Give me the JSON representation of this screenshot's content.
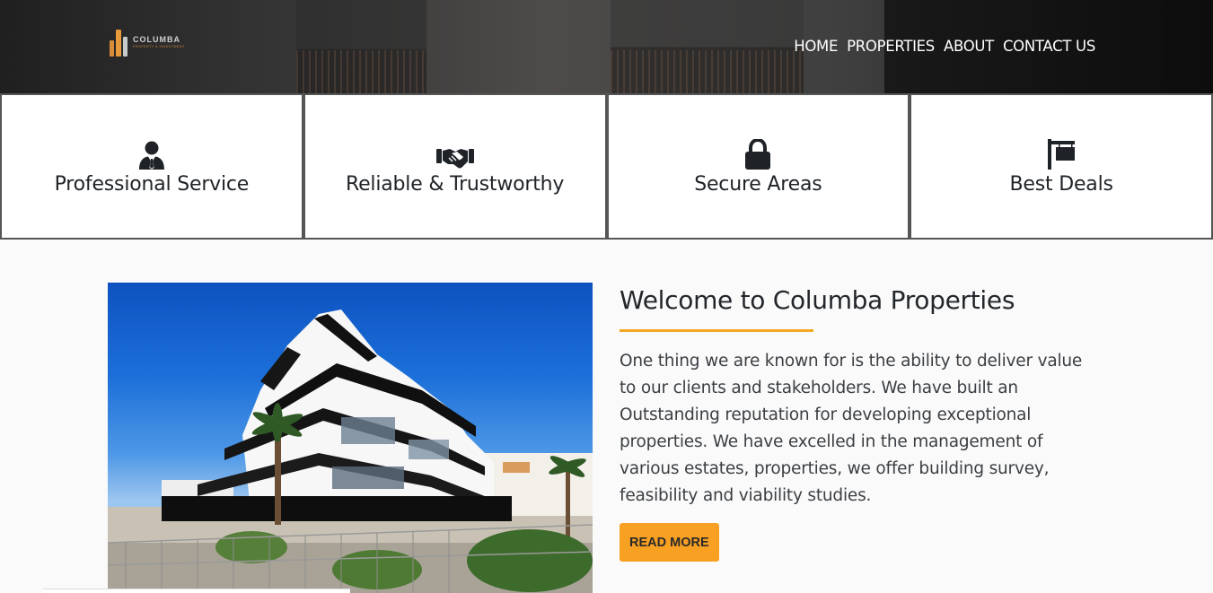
{
  "header": {
    "logo": {
      "name": "COLUMBA",
      "tagline": "PROPERTY & INVESTMENT"
    },
    "nav": [
      "HOME",
      "PROPERTIES",
      "ABOUT",
      "CONTACT US"
    ]
  },
  "features": [
    {
      "label": "Professional Service",
      "icon": "user-tie-icon"
    },
    {
      "label": "Reliable & Trustworthy",
      "icon": "handshake-icon"
    },
    {
      "label": "Secure Areas",
      "icon": "lock-icon"
    },
    {
      "label": "Best Deals",
      "icon": "sign-icon"
    }
  ],
  "welcome": {
    "title": "Welcome to Columba Properties",
    "text": "One thing we are known for is the ability to deliver value to our clients and stakeholders. We have built an Outstanding reputation for developing exceptional properties. We have excelled in the management of various estates, properties, we offer building survey, feasibility and viability studies.",
    "button": "READ MORE"
  },
  "colors": {
    "accent": "#f7a022",
    "header": "#141414",
    "text": "#212529"
  }
}
